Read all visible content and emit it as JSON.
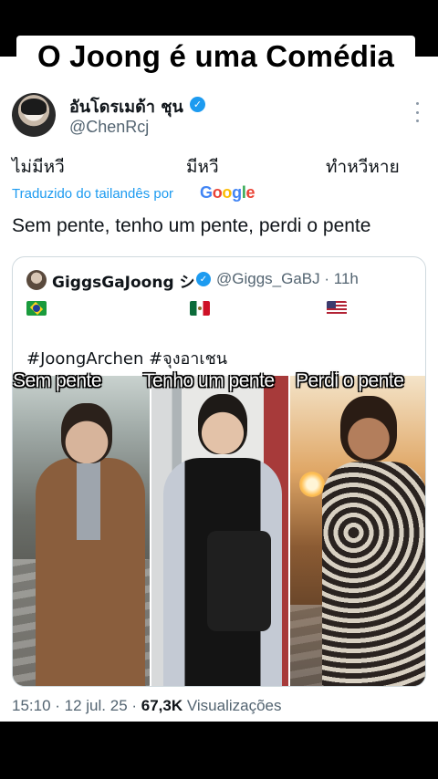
{
  "caption": "O Joong é uma Comédia",
  "tweet": {
    "display_name": "อันโดรเมด้า ชุน",
    "handle": "@ChenRcj",
    "original_words": [
      "ไม่มีหวี",
      "มีหวี",
      "ทำหวีหาย"
    ],
    "translated_by": "Traduzido do tailandês por",
    "translator": "Google",
    "text": "Sem pente, tenho um pente, perdi o pente",
    "timestamp": "15:10 · 12 jul. 25 · ",
    "views_count": "67,3K",
    "views_label": " Visualizações"
  },
  "quote": {
    "name": "GiggsGaJoong シ",
    "handle_time": "@Giggs_GaBJ · 11h",
    "flags": [
      "brazil-flag",
      "mexico-flag",
      "usa-flag"
    ],
    "hashtags": "#JoongArchen  #จุงอาเชน",
    "overlays": [
      "Sem pente",
      "Tenho um pente",
      "Perdi o pente"
    ]
  },
  "colors": {
    "accent": "#1d9bf0",
    "secondary_text": "#536471"
  }
}
